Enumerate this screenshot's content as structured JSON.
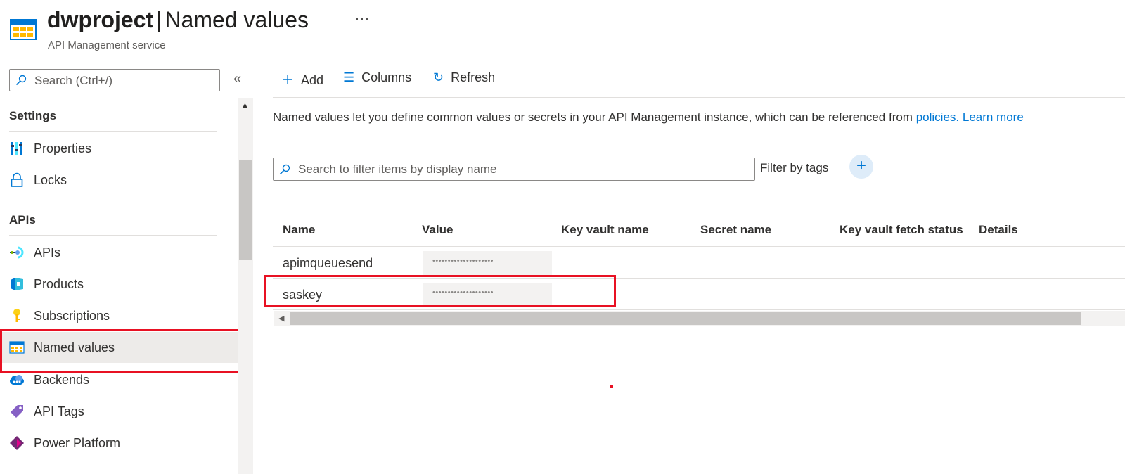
{
  "header": {
    "service_name": "dwproject",
    "page_name": "Named values",
    "subtitle": "API Management service",
    "more": "···"
  },
  "sidebar": {
    "search_placeholder": "Search (Ctrl+/)",
    "collapse": "«",
    "sections": [
      {
        "title": "Settings",
        "items": [
          {
            "label": "Properties",
            "icon": "properties-icon"
          },
          {
            "label": "Locks",
            "icon": "lock-icon"
          }
        ]
      },
      {
        "title": "APIs",
        "items": [
          {
            "label": "APIs",
            "icon": "apis-icon"
          },
          {
            "label": "Products",
            "icon": "products-icon"
          },
          {
            "label": "Subscriptions",
            "icon": "key-icon"
          },
          {
            "label": "Named values",
            "icon": "named-values-icon",
            "selected": true
          },
          {
            "label": "Backends",
            "icon": "backends-icon"
          },
          {
            "label": "API Tags",
            "icon": "tag-icon"
          },
          {
            "label": "Power Platform",
            "icon": "power-platform-icon"
          }
        ]
      }
    ]
  },
  "toolbar": {
    "add": "Add",
    "columns": "Columns",
    "refresh": "Refresh"
  },
  "description": {
    "text": "Named values let you define common values or secrets in your API Management instance, which can be referenced from ",
    "link_policies": "policies.",
    "link_learn_more": "Learn more"
  },
  "filter": {
    "placeholder": "Search to filter items by display name",
    "tags_label": "Filter by tags",
    "add_tag": "+"
  },
  "table": {
    "columns": [
      "Name",
      "Value",
      "Key vault name",
      "Secret name",
      "Key vault fetch status",
      "Details"
    ],
    "rows": [
      {
        "name": "apimqueuesend",
        "value": "••••••••••••••••••••"
      },
      {
        "name": "saskey",
        "value": "••••••••••••••••••••"
      }
    ]
  },
  "colors": {
    "accent": "#0078d4",
    "highlight_red": "#e81123",
    "selected_bg": "#edebe9"
  }
}
